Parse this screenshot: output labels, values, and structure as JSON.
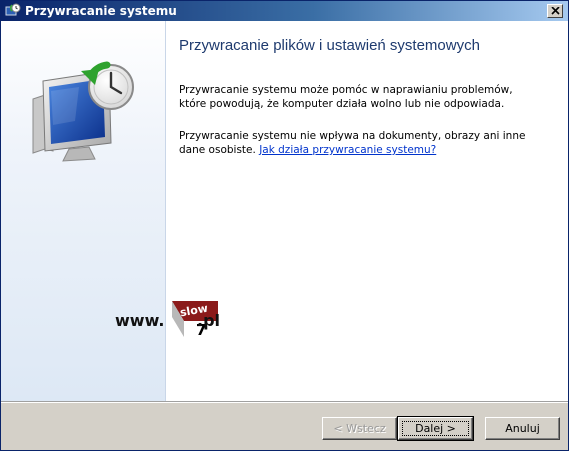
{
  "window": {
    "title": "Przywracanie systemu",
    "title_icon": "system-restore-icon",
    "close_icon": "close-icon"
  },
  "sidebar": {
    "icon": "system-restore-monitor-clock-icon"
  },
  "main": {
    "heading": "Przywracanie plików i ustawień systemowych",
    "paragraph1": "Przywracanie systemu może pomóc w naprawianiu problemów, które powodują, że komputer działa wolno lub nie odpowiada.",
    "paragraph2_text": "Przywracanie systemu nie wpływa na dokumenty, obrazy ani inne dane osobiste.",
    "paragraph2_link": "Jak działa przywracanie systemu?"
  },
  "watermark": {
    "prefix": "www.",
    "logo_top": "slow",
    "logo_bottom": "7",
    "suffix": ".pl"
  },
  "buttons": {
    "back": "< Wstecz",
    "next": "Dalej >",
    "cancel": "Anuluj"
  },
  "colors": {
    "title_bar_start": "#0a246a",
    "title_bar_end": "#a6caf0",
    "heading": "#1e3a6e",
    "link": "#0033cc",
    "dialog_face": "#d4d0c8"
  }
}
